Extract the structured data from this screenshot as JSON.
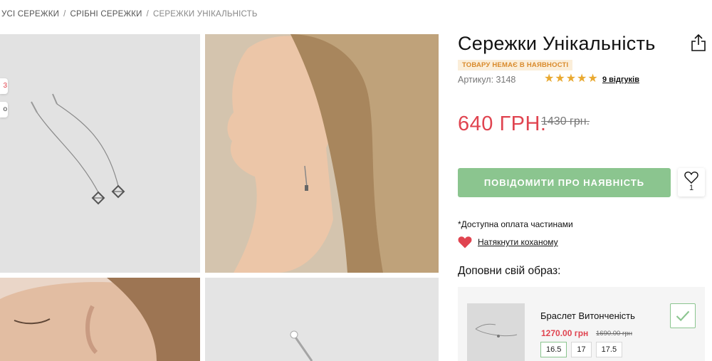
{
  "breadcrumb": {
    "items": [
      {
        "label": "УСІ СЕРЕЖКИ"
      },
      {
        "label": "СРІБНІ СЕРЕЖКИ"
      },
      {
        "label": "СЕРЕЖКИ УНІКАЛЬНІСТЬ"
      }
    ]
  },
  "gallery": {
    "badges": [
      "3",
      "о"
    ]
  },
  "product": {
    "title": "Сережки Унікальність",
    "stock_status": "ТОВАРУ НЕМАЄ В НАЯВНОСТІ",
    "sku": "Артикул: 3148",
    "rating": 5,
    "reviews": "9 відгуків",
    "price": "640 ГРН.",
    "old_price": "1430 грн.",
    "notify_button": "ПОВІДОМИТИ ПРО НАЯВНІСТЬ",
    "wishlist_count": "1",
    "installment_note": "*Доступна оплата частинами",
    "hint_link": "Натякнути коханому"
  },
  "complete_look": {
    "title": "Доповни свій образ:",
    "item": {
      "name": "Браслет Витонченість",
      "price": "1270.00 грн",
      "old_price": "1690.00 грн",
      "sizes": [
        "16.5",
        "17",
        "17.5"
      ],
      "selected_size": "16.5"
    }
  },
  "colors": {
    "accent_price": "#e04450",
    "button_green": "#8bc58f",
    "stock_badge_bg": "#fbeed9",
    "stock_badge_text": "#d98a2b",
    "star": "#e9a931"
  }
}
